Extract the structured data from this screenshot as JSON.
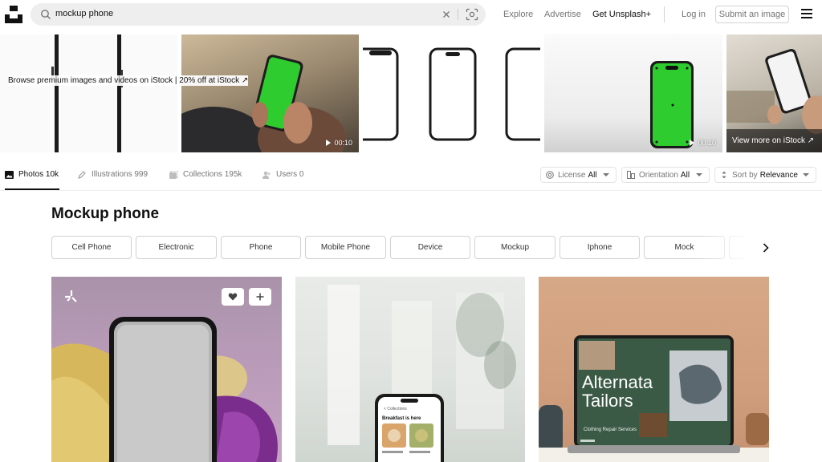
{
  "search": {
    "query": "mockup phone"
  },
  "nav": {
    "explore": "Explore",
    "advertise": "Advertise",
    "get_plus": "Get Unsplash+",
    "login": "Log in",
    "submit": "Submit an image"
  },
  "istock": {
    "promo_main": "Browse premium images and videos on iStock",
    "promo_sep": " | ",
    "promo_offer": "20% off at iStock ↗",
    "durations": [
      "00:10",
      "00:10"
    ],
    "view_more": "View more on iStock ↗"
  },
  "tabs": [
    {
      "label": "Photos 10k",
      "icon": "photo-icon"
    },
    {
      "label": "Illustrations 999",
      "icon": "pen-icon"
    },
    {
      "label": "Collections 195k",
      "icon": "collections-icon"
    },
    {
      "label": "Users 0",
      "icon": "users-icon"
    }
  ],
  "filters": {
    "license": {
      "label": "License",
      "value": "All"
    },
    "orientation": {
      "label": "Orientation",
      "value": "All"
    },
    "sort": {
      "label": "Sort by",
      "value": "Relevance"
    }
  },
  "page_title": "Mockup phone",
  "related": [
    "Cell Phone",
    "Electronic",
    "Phone",
    "Mobile Phone",
    "Device",
    "Mockup",
    "Iphone",
    "Mock"
  ],
  "photos": {
    "p2_screen": {
      "header": "< Collections",
      "sub": "Breakfast is here"
    },
    "p3_screen": {
      "title_line1": "Alternata",
      "title_line2": "Tailors",
      "subtitle": "Clothing Repair Services"
    }
  },
  "colors": {
    "green_screen": "#2ecc2e",
    "accent": "#111111",
    "muted": "#767676"
  }
}
